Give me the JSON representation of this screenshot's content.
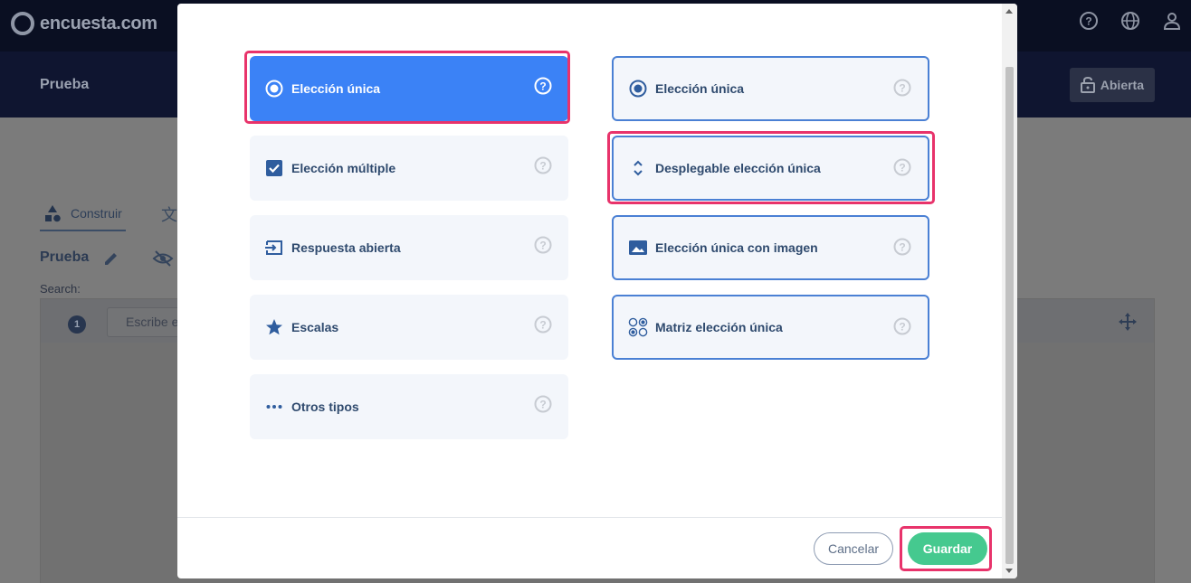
{
  "app": {
    "logo_text": "encuesta.com",
    "survey_title": "Prueba",
    "status_button": "Abierta"
  },
  "background": {
    "tab_build": "Construir",
    "survey_name": "Prueba",
    "search_label": "Search:",
    "question_number": "1",
    "question_placeholder": "Escribe e"
  },
  "modal": {
    "left_options": [
      {
        "label": "Elección única",
        "icon": "radio-icon",
        "active": true
      },
      {
        "label": "Elección múltiple",
        "icon": "checkbox-icon"
      },
      {
        "label": "Respuesta abierta",
        "icon": "open-answer-icon"
      },
      {
        "label": "Escalas",
        "icon": "star-icon"
      },
      {
        "label": "Otros tipos",
        "icon": "more-icon"
      }
    ],
    "right_options": [
      {
        "label": "Elección única",
        "icon": "radio-icon"
      },
      {
        "label": "Desplegable elección única",
        "icon": "dropdown-icon"
      },
      {
        "label": "Elección única con imagen",
        "icon": "image-icon"
      },
      {
        "label": "Matriz elección única",
        "icon": "matrix-icon"
      }
    ],
    "cancel_label": "Cancelar",
    "save_label": "Guardar"
  },
  "colors": {
    "accent": "#3b82f6",
    "save": "#45c98f",
    "highlight": "#e8336b"
  }
}
